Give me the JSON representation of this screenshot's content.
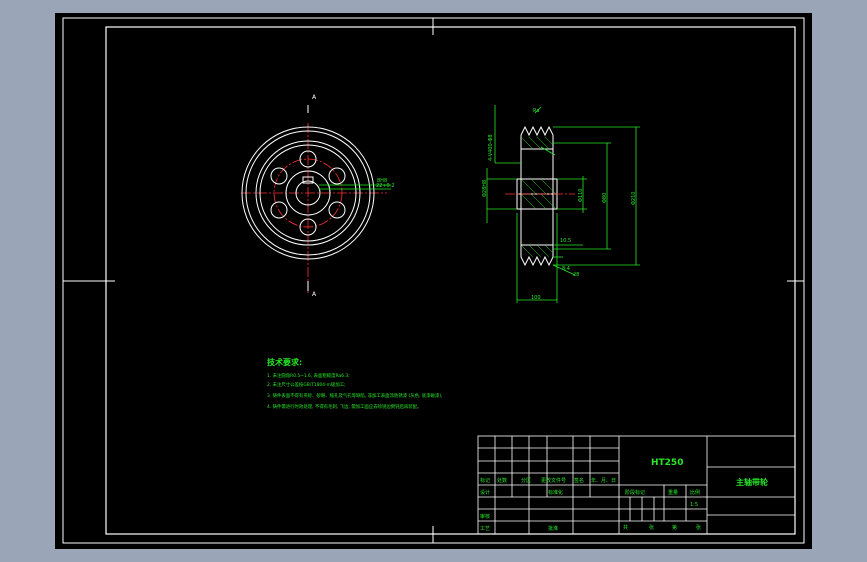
{
  "views": {
    "section_mark_top": "A",
    "section_mark_bottom": "A",
    "front_view": {
      "keyway_callout_1": "8H8",
      "keyway_callout_2": "22+0.2"
    },
    "side_view": {
      "groove_callout": "4-V400-Φ8",
      "ra_note": "Ra",
      "dim_left": "Φ28H8",
      "dim_hub": "Φ110",
      "dim_groove_bottom": "Φ80",
      "dim_outer": "Φ210",
      "dim_groove": "10.5",
      "dim_step": "8.4",
      "dim_pitch": "28",
      "dim_width": "100"
    }
  },
  "technical_requirements": {
    "heading": "技术要求:",
    "items": [
      "1. 未注圆角R0.5~1.6, 表面粗糙度Ra6.3;",
      "2. 未注尺寸公差按GB/T1804-m级加工;",
      "3. 铸件表面不得有夹砂、砂眼、缩孔及气孔等缺陷, 非加工表面涂防锈漆 (灰色, 底漆磁漆),",
      "4. 铸件需进行时效处理, 不得有毛刺, 飞边, 需加工面应去除锐边倒钝后再装配。"
    ]
  },
  "title_block": {
    "material": "HT250",
    "part_name": "主轴带轮",
    "row_labels": {
      "mark": "标记",
      "count": "处数",
      "zone": "分区",
      "change_doc": "更改文件号",
      "sign": "签名",
      "date": "年、月、日",
      "design": "设计",
      "standardize": "标准化",
      "review": "审核",
      "process": "工艺",
      "approve": "批准"
    },
    "stage_mark": "阶段标记",
    "weight": "重量",
    "scale_label": "比例",
    "scale_value": "1:5",
    "total": "共",
    "sheets": "张",
    "sheet_no": "第",
    "sheet_unit": "张"
  }
}
